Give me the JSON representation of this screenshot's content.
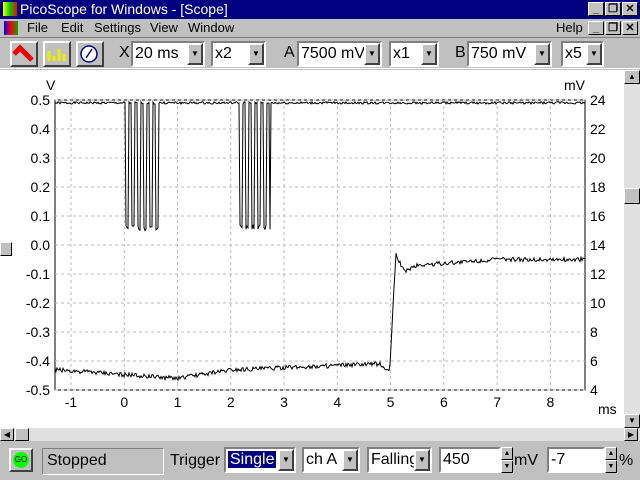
{
  "window": {
    "title": "PicoScope for Windows - [Scope]"
  },
  "menu": {
    "items": [
      "File",
      "Edit",
      "Settings",
      "View",
      "Window"
    ],
    "help": "Help"
  },
  "toolbar": {
    "x_label": "X",
    "timebase": "20 ms",
    "x_mult": "x2",
    "a_label": "A",
    "a_range": "7500 mV",
    "a_mult": "x1",
    "b_label": "B",
    "b_range": "750 mV",
    "b_mult": "x5"
  },
  "status": {
    "go": "GO",
    "state": "Stopped",
    "trigger_label": "Trigger",
    "trigger_mode": "Single",
    "trigger_channel": "ch A",
    "trigger_edge": "Falling",
    "trigger_level": "450",
    "level_unit": "mV",
    "delay": "-7",
    "delay_unit": "%"
  },
  "chart_data": {
    "type": "line",
    "ylabel_left": "V",
    "ylabel_right": "mV",
    "xlabel": "ms",
    "xlim": [
      -1.3,
      8.65
    ],
    "ylim": [
      -0.5,
      0.5
    ],
    "ylim_right": [
      4,
      24
    ],
    "x_ticks": [
      "-1",
      "0",
      "1",
      "2",
      "3",
      "4",
      "5",
      "6",
      "7",
      "8"
    ],
    "y_ticks": [
      "0.5",
      "0.4",
      "0.3",
      "0.2",
      "0.1",
      "0.0",
      "-0.1",
      "-0.2",
      "-0.3",
      "-0.4",
      "-0.5"
    ],
    "y_ticks_right": [
      "24",
      "22",
      "20",
      "18",
      "16",
      "14",
      "12",
      "10",
      "8",
      "6",
      "4"
    ],
    "grid": true,
    "series": [
      {
        "name": "ch A",
        "high": 0.49,
        "low": 0.05,
        "bursts": [
          [
            0.0,
            0.65
          ],
          [
            2.1,
            2.75
          ]
        ]
      },
      {
        "name": "ch B",
        "points": [
          [
            -1.3,
            -0.43
          ],
          [
            1.0,
            -0.46
          ],
          [
            2.0,
            -0.43
          ],
          [
            4.8,
            -0.41
          ],
          [
            4.98,
            -0.44
          ],
          [
            5.1,
            -0.03
          ],
          [
            5.25,
            -0.09
          ],
          [
            5.5,
            -0.07
          ],
          [
            7.0,
            -0.05
          ],
          [
            8.5,
            -0.05
          ]
        ]
      }
    ]
  }
}
